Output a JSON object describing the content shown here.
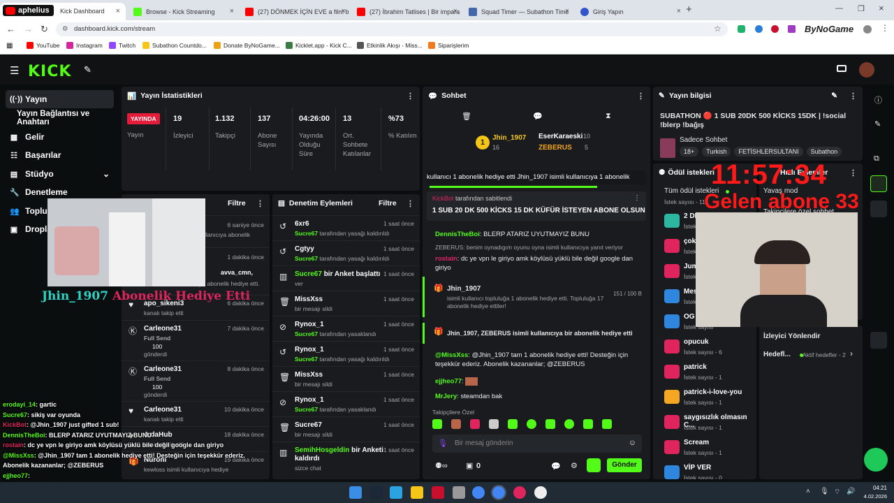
{
  "browser": {
    "tabs": [
      {
        "label": "Kick Dashboard",
        "color": "#53fc18"
      },
      {
        "label": "Browse - Kick Streaming",
        "color": "#53fc18"
      },
      {
        "label": "(27) DÖNMEK İÇİN EVE a film b",
        "color": "#ff0000"
      },
      {
        "label": "(27) İbrahim Tatlises | Bir impara",
        "color": "#ff0000"
      },
      {
        "label": "Squad Timer — Subathon Time",
        "color": "#4466aa"
      },
      {
        "label": "Giriş Yapın",
        "color": "#3355cc"
      }
    ],
    "url": "dashboard.kick.com/stream",
    "bookmarks": [
      "YouTube",
      "Instagram",
      "Twitch",
      "Subathon Countdo...",
      "Donate ByNoGame...",
      "Kicklet.app - Kick C...",
      "Etkinlik Akışı - Miss...",
      "Siparişlerim"
    ],
    "profile_brand": "ByNoGame"
  },
  "overlay": {
    "channel_tag": "aphelius",
    "timer": "11:57:34",
    "sub_goal": "Gelen abone 33",
    "gift_name": "Jhin_1907",
    "gift_text": "Abonelik Hediye Etti"
  },
  "sidebar": {
    "items": [
      "Yayın",
      "Yayın Bağlantısı ve Anahtarı",
      "Gelir",
      "Başarılar",
      "Stüdyo",
      "Denetleme",
      "Topluluk",
      "Droplar"
    ]
  },
  "stats": {
    "title": "Yayın İstatistikleri",
    "live": "YAYINDA",
    "live_label": "Yayın",
    "items": [
      {
        "value": "19",
        "label": "İzleyici"
      },
      {
        "value": "1.132",
        "label": "Takipçi"
      },
      {
        "value": "137",
        "label": "Abone Sayısı"
      },
      {
        "value": "04:26:00",
        "label": "Yayında Olduğu Süre"
      },
      {
        "value": "13",
        "label": "Ort. Sohbete Katılanlar"
      },
      {
        "value": "%73",
        "label": "% Katılım"
      }
    ]
  },
  "activity": {
    "filter": "Filtre",
    "rows": [
      {
        "title": "",
        "sub": "kullanıcıya abonelik",
        "time": "6 saniye önce"
      },
      {
        "title": "avva_cmn,",
        "sub": "kullanıcıya abonelik hediye etti.",
        "time": "1 dakika önce"
      },
      {
        "title": "apo_sikeni3",
        "sub": "kanalı takip etti",
        "time": "6 dakika önce"
      },
      {
        "title": "Carleone31",
        "sub": "Full Send",
        "amount": "100",
        "amount_label": "gönderdi",
        "time": "7 dakika önce"
      },
      {
        "title": "Carleone31",
        "sub": "Full Send",
        "amount": "100",
        "amount_label": "gönderdi",
        "time": "8 dakika önce"
      },
      {
        "title": "Carleone31",
        "sub": "kanalı takip etti",
        "time": "10 dakika önce"
      },
      {
        "title": "4rdaHub",
        "sub": "kanalı takip etti",
        "time": "18 dakika önce"
      },
      {
        "title": "Nuroni",
        "sub": "kewloss isimli kullanıcıya hediye",
        "time": "19 dakika önce"
      }
    ]
  },
  "moderation": {
    "title": "Denetim Eylemleri",
    "filter": "Filtre",
    "rows": [
      {
        "title": "6xr6",
        "actor": "Sucre67",
        "sub": "tarafından yasağı kaldırıldı",
        "time": "1 saat önce"
      },
      {
        "title": "Cgtyy",
        "actor": "Sucre67",
        "sub": "tarafından yasağı kaldırıldı",
        "time": "1 saat önce"
      },
      {
        "title": "bir Anket başlattı",
        "actor": "Sucre67",
        "sub": "ver",
        "time": "1 saat önce"
      },
      {
        "title": "MissXss",
        "actor": "",
        "sub": "bir mesajı sildi",
        "time": "1 saat önce"
      },
      {
        "title": "Rynox_1",
        "actor": "Sucre67",
        "sub": "tarafından yasaklandı",
        "time": "1 saat önce"
      },
      {
        "title": "Rynox_1",
        "actor": "Sucre67",
        "sub": "tarafından yasağı kaldırıldı",
        "time": "1 saat önce"
      },
      {
        "title": "MissXss",
        "actor": "",
        "sub": "bir mesajı sildi",
        "time": "1 saat önce"
      },
      {
        "title": "Rynox_1",
        "actor": "Sucre67",
        "sub": "tarafından yasaklandı",
        "time": "1 saat önce"
      },
      {
        "title": "Sucre67",
        "actor": "",
        "sub": "bir mesajı sildi",
        "time": "1 saat önce"
      },
      {
        "title": "bir Anketi kaldırdı",
        "actor": "SemihHosgeldin",
        "sub": "sizce chat",
        "time": "1 saat önce"
      }
    ]
  },
  "chat": {
    "title": "Sohbet",
    "top": [
      {
        "name": "Jhin_1907",
        "count": "16"
      },
      {
        "name": "EserKaraeski",
        "count": "10"
      },
      {
        "name": "ZEBERUS",
        "count": "5"
      }
    ],
    "ticker": "kullanıcı 1 abonelik hediye etti  Jhin_1907 isimli kullanıcıya 1 abonelik",
    "pinned_by": "tarafından sabitlendi",
    "pinned_user": "KickBot",
    "pinned": "1 SUB 20 DK 500 KİCKS 15 DK KÜFÜR İSTEYEN ABONE OLSUN",
    "messages": [
      {
        "user": "DennisTheBoi",
        "text": "BLERP ATARIZ UYUTMAYIZ BUNU"
      },
      {
        "user": "",
        "text": "ZEBERUS: benim oynadıgım oyunu oyna isimli kullanıcıya yanıt veriyor"
      },
      {
        "user": "rostain",
        "text": "dc ye vpn le giriyo amk köylüsü yüklü bile değil google dan giriyo"
      }
    ],
    "gift1_user": "Jhin_1907",
    "gift1_text": "isimli kullanıcı topluluğa 1 abonelik hediye etti. Topluluğa 17 abonelik hediye ettiler!",
    "gift1_progress": "151 / 100 B",
    "gift2_text": "Jhin_1907, ZEBERUS isimli kullanıcıya bir abonelik hediye etti",
    "messages2": [
      {
        "user": "@MissXss",
        "text": "@Jhin_1907 tam 1 abonelik hediye etti! Desteğin için teşekkür ederiz. Abonelik kazananlar; @ZEBERUS"
      },
      {
        "user": "ejjheo77",
        "text": ""
      },
      {
        "user": "MrJery",
        "text": "steamdan bak"
      }
    ],
    "followers_only": "Takipçilere Özel",
    "placeholder": "Bir mesaj gönderin",
    "points": "0",
    "send": "Gönder"
  },
  "info": {
    "title": "Yayın bilgisi",
    "stream_title": "SUBATHON 🔴 1 SUB 20DK 500 KİCKS 15DK | !social !blerp !bağış",
    "category": "Sadece Sohbet",
    "tags": [
      "18+",
      "Turkish",
      "FETİSHLERSULTANI",
      "Subathon"
    ]
  },
  "rewards": {
    "title": "Ödül istekleri",
    "all": "Tüm ödül istekleri",
    "all_count": "İstek sayısı - 11",
    "items": [
      {
        "name": "2 DK",
        "count": "İstek sayısı",
        "color": "#2db7a0"
      },
      {
        "name": "çok",
        "count": "İstek sayısı",
        "color": "#e0245e"
      },
      {
        "name": "Jum",
        "count": "İstek sayısı",
        "color": "#e0245e"
      },
      {
        "name": "Mes",
        "count": "İstek sayısı",
        "color": "#2e86de"
      },
      {
        "name": "OG V",
        "count": "İstek sayısı",
        "color": "#2e86de"
      },
      {
        "name": "opucuk",
        "count": "İstek sayısı - 6",
        "color": "#e0245e"
      },
      {
        "name": "patrick",
        "count": "İstek sayısı - 1",
        "color": "#e0245e"
      },
      {
        "name": "patrick-i-love-you",
        "count": "İstek sayısı - 1",
        "color": "#f5a623"
      },
      {
        "name": "saygısızlık olmasın C...",
        "count": "İstek sayısı - 1",
        "color": "#e0245e"
      },
      {
        "name": "Scream",
        "count": "İstek sayısı - 1",
        "color": "#e0245e"
      },
      {
        "name": "VİP VER",
        "count": "İstek sayısı - 0",
        "color": "#2e86de"
      }
    ]
  },
  "actions": {
    "title": "Hızlı Eylemler",
    "slow": "Yavaş mod",
    "followers": "Takipçilere özel sohbet",
    "redirect_title": "İzleyici Yönlendir",
    "goals": "Hedefl...",
    "active_goals": "Aktif hedefler - 2"
  },
  "stream_chat": [
    {
      "user": "erodayi_14",
      "text": ": gartic"
    },
    {
      "user": "Sucre67",
      "text": ": sikiş var oyunda"
    },
    {
      "user": "KickBot",
      "text": ": @Jhin_1907 just gifted 1 sub!"
    },
    {
      "user": "DennisTheBoi",
      "text": ": BLERP ATARIZ UYUTMAYIZ BUNU"
    },
    {
      "user": "rostain",
      "text": ": dc ye vpn le giriyo amk köylüsü yüklü bile değil google dan giriyo"
    },
    {
      "user": "@MissXss",
      "text": ": @Jhin_1907 tam 1 abonelik hediye etti! Desteğin için teşekkür ederiz."
    },
    {
      "user": "",
      "text": "Abonelik kazananlar; @ZEBERUS"
    },
    {
      "user": "ejjheo77",
      "text": ":"
    },
    {
      "user": "MrJery",
      "text": ": steamdan bak"
    }
  ],
  "clock": {
    "time": "04:21",
    "date": "4.02.2026"
  }
}
